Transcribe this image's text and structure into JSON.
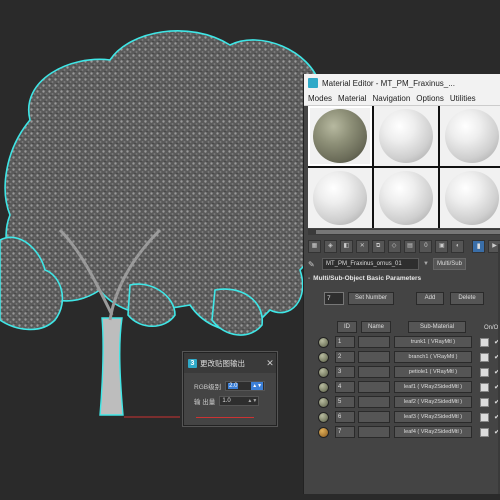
{
  "material_editor": {
    "window_title": "Material Editor - MT_PM_Fraxinus_...",
    "menu": [
      "Modes",
      "Material",
      "Navigation",
      "Options",
      "Utilities"
    ],
    "material_name": "MT_PM_Fraxinus_ornus_01",
    "material_type": "Multi/Sub",
    "rollout_title": "Multi/Sub-Object Basic Parameters",
    "num_materials": "7",
    "set_number_label": "Set Number",
    "add_label": "Add",
    "delete_label": "Delete",
    "columns": {
      "id": "ID",
      "name": "Name",
      "sub_material": "Sub-Material",
      "on_off": "On/O"
    },
    "rows": [
      {
        "id": "1",
        "sub_material": "trunk1  ( VRayMtl )",
        "swatch": "moss"
      },
      {
        "id": "2",
        "sub_material": "branch1  ( VRayMtl )",
        "swatch": "moss"
      },
      {
        "id": "3",
        "sub_material": "petiole1  ( VRayMtl )",
        "swatch": "moss"
      },
      {
        "id": "4",
        "sub_material": "leaf1  ( VRay2SidedMtl )",
        "swatch": "moss"
      },
      {
        "id": "5",
        "sub_material": "leaf2  ( VRay2SidedMtl )",
        "swatch": "moss"
      },
      {
        "id": "6",
        "sub_material": "leaf3  ( VRay2SidedMtl )",
        "swatch": "moss"
      },
      {
        "id": "7",
        "sub_material": "leaf4  ( VRay2SidedMtl )",
        "swatch": "wood"
      }
    ]
  },
  "dialog": {
    "title": "更改贴图输出",
    "rgb_level_label": "RGB级别",
    "rgb_level_value": "2.0",
    "output_amount_label": "输 出量",
    "output_amount_value": "1.0",
    "close_glyph": "✕"
  },
  "colors": {
    "viewport_bg": "#2a2a2a",
    "selection_outline": "#3fe6e6",
    "ui_panel": "#444444",
    "accent_blue": "#3c7fd6"
  }
}
